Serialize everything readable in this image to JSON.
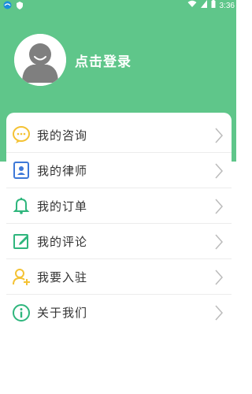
{
  "status_bar": {
    "time": "3:36",
    "icons": [
      "app-icon",
      "shield-icon",
      "wifi-icon",
      "signal-icon",
      "battery-icon"
    ]
  },
  "profile": {
    "login_text": "点击登录",
    "avatar": "default-avatar-icon"
  },
  "menu": {
    "items": [
      {
        "label": "我的咨询",
        "icon": "chat-bubble-icon"
      },
      {
        "label": "我的律师",
        "icon": "lawyer-card-icon"
      },
      {
        "label": "我的订单",
        "icon": "bell-icon"
      },
      {
        "label": "我的评论",
        "icon": "edit-icon"
      },
      {
        "label": "我要入驻",
        "icon": "add-user-icon"
      },
      {
        "label": "关于我们",
        "icon": "info-icon"
      }
    ]
  },
  "colors": {
    "header": "#5fc68a",
    "yellow": "#f4c234",
    "blue": "#3d78d8",
    "green": "#2fb67d"
  }
}
